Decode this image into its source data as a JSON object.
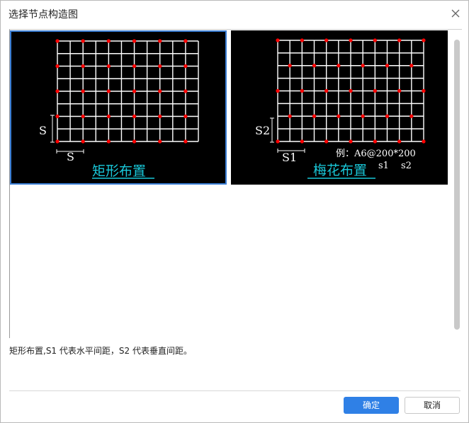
{
  "dialog": {
    "title": "选择节点构造图",
    "description": "矩形布置,S1 代表水平间距，S2 代表垂直间距。",
    "ok_label": "确定",
    "cancel_label": "取消"
  },
  "options": [
    {
      "caption": "矩形布置",
      "spacing_label_h": "S",
      "spacing_label_v": "S",
      "selected": true
    },
    {
      "caption": "梅花布置",
      "spacing_label_h": "S1",
      "spacing_label_v": "S2",
      "example": "例：A6@200*200",
      "example_s1": "s1",
      "example_s2": "s2",
      "selected": false
    }
  ],
  "colors": {
    "accent": "#2f80e6",
    "selection_border": "#3b7fd6",
    "caption": "#19c7d8",
    "node": "#ff0000",
    "grid": "#ffffff"
  },
  "icons": {
    "close": "close-icon"
  }
}
